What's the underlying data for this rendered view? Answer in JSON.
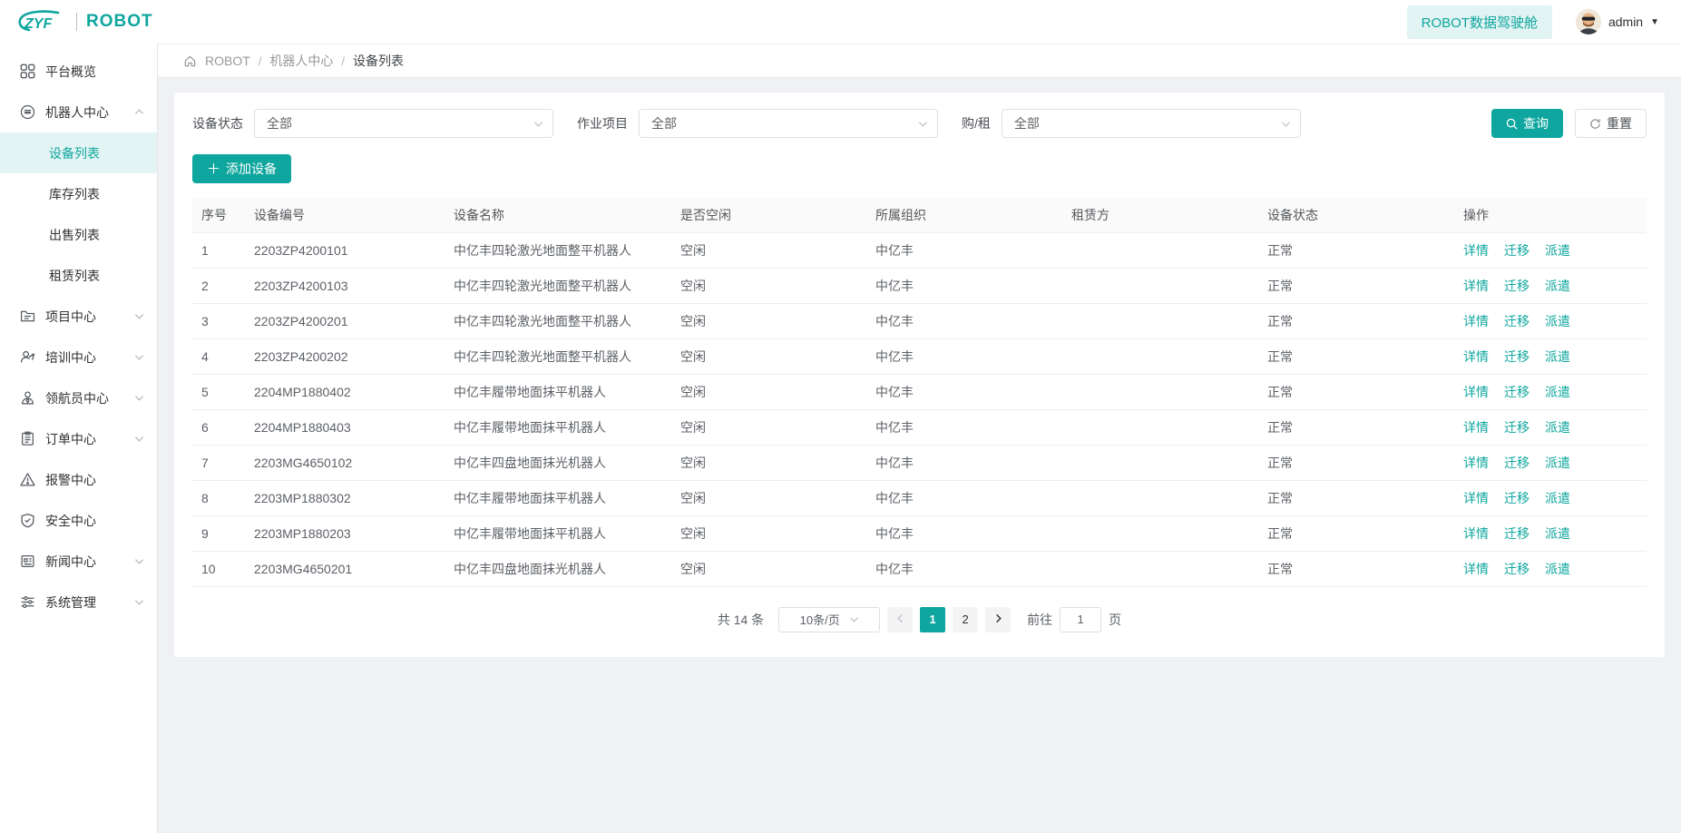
{
  "colors": {
    "primary": "#0ea69e",
    "primary_light": "#e1f3f2",
    "sidebar_active_bg": "#e2f4f3",
    "page_bg": "#f0f1f4"
  },
  "header": {
    "logo_zyf": "ZYF",
    "logo_robot": "ROBOT",
    "dashboard_button": "ROBOT数据驾驶舱",
    "username": "admin"
  },
  "breadcrumb": {
    "items": [
      "ROBOT",
      "机器人中心",
      "设备列表"
    ],
    "separator": "/"
  },
  "sidebar": {
    "items": [
      {
        "label": "平台概览",
        "icon": "grid-icon"
      },
      {
        "label": "机器人中心",
        "icon": "robot-icon",
        "expanded": true,
        "children": [
          "设备列表",
          "库存列表",
          "出售列表",
          "租赁列表"
        ],
        "active_child": "设备列表"
      },
      {
        "label": "项目中心",
        "icon": "folder-icon"
      },
      {
        "label": "培训中心",
        "icon": "trainer-icon"
      },
      {
        "label": "领航员中心",
        "icon": "pilot-icon"
      },
      {
        "label": "订单中心",
        "icon": "order-icon"
      },
      {
        "label": "报警中心",
        "icon": "alarm-icon"
      },
      {
        "label": "安全中心",
        "icon": "shield-icon"
      },
      {
        "label": "新闻中心",
        "icon": "news-icon"
      },
      {
        "label": "系统管理",
        "icon": "settings-icon"
      }
    ]
  },
  "filters": {
    "fields": [
      {
        "label": "设备状态",
        "value": "全部"
      },
      {
        "label": "作业项目",
        "value": "全部"
      },
      {
        "label": "购/租",
        "value": "全部"
      }
    ],
    "search_button": "查询",
    "reset_button": "重置"
  },
  "toolbar": {
    "add_button": "添加设备"
  },
  "table": {
    "columns": [
      "序号",
      "设备编号",
      "设备名称",
      "是否空闲",
      "所属组织",
      "租赁方",
      "设备状态",
      "操作"
    ],
    "action_labels": [
      "详情",
      "迁移",
      "派遣"
    ],
    "rows": [
      [
        "1",
        "2203ZP4200101",
        "中亿丰四轮激光地面整平机器人",
        "空闲",
        "中亿丰",
        "",
        "正常"
      ],
      [
        "2",
        "2203ZP4200103",
        "中亿丰四轮激光地面整平机器人",
        "空闲",
        "中亿丰",
        "",
        "正常"
      ],
      [
        "3",
        "2203ZP4200201",
        "中亿丰四轮激光地面整平机器人",
        "空闲",
        "中亿丰",
        "",
        "正常"
      ],
      [
        "4",
        "2203ZP4200202",
        "中亿丰四轮激光地面整平机器人",
        "空闲",
        "中亿丰",
        "",
        "正常"
      ],
      [
        "5",
        "2204MP1880402",
        "中亿丰履带地面抹平机器人",
        "空闲",
        "中亿丰",
        "",
        "正常"
      ],
      [
        "6",
        "2204MP1880403",
        "中亿丰履带地面抹平机器人",
        "空闲",
        "中亿丰",
        "",
        "正常"
      ],
      [
        "7",
        "2203MG4650102",
        "中亿丰四盘地面抹光机器人",
        "空闲",
        "中亿丰",
        "",
        "正常"
      ],
      [
        "8",
        "2203MP1880302",
        "中亿丰履带地面抹平机器人",
        "空闲",
        "中亿丰",
        "",
        "正常"
      ],
      [
        "9",
        "2203MP1880203",
        "中亿丰履带地面抹平机器人",
        "空闲",
        "中亿丰",
        "",
        "正常"
      ],
      [
        "10",
        "2203MG4650201",
        "中亿丰四盘地面抹光机器人",
        "空闲",
        "中亿丰",
        "",
        "正常"
      ]
    ]
  },
  "pagination": {
    "total_text": "共 14 条",
    "page_size_value": "10条/页",
    "pages": [
      "1",
      "2"
    ],
    "active_page": "1",
    "goto_label": "前往",
    "goto_value": "1",
    "goto_suffix": "页"
  }
}
